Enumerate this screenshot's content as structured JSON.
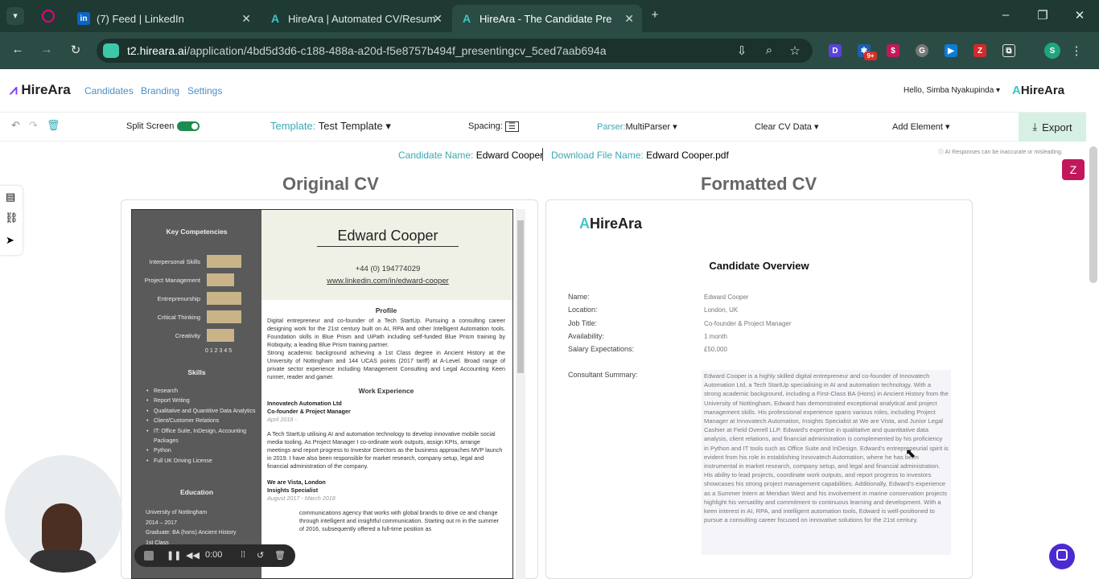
{
  "browser": {
    "tabs": [
      {
        "label": "(7) Feed | LinkedIn",
        "icon": "linkedin-icon"
      },
      {
        "label": "HireAra | Automated CV/Resum",
        "icon": "hireara-icon"
      },
      {
        "label": "HireAra - The Candidate Pre",
        "icon": "hireara-icon"
      }
    ],
    "url_host": "t2.hireara.ai",
    "url_path": "/application/4bd5d3d6-c188-488a-a20d-f5e8757b494f_presentingcv_5ced7aab694a",
    "badge_count": "9+",
    "profile_initial": "S",
    "theme_color": "#2b4c44"
  },
  "nav": {
    "brand": "HireAra",
    "links": [
      "Candidates",
      "Branding",
      "Settings"
    ],
    "greeting": "Hello, Simba Nyakupinda",
    "brand_right": "HireAra"
  },
  "toolbar": {
    "split_screen": "Split Screen",
    "toggle": "On",
    "template_label": "Template:",
    "template_value": "Test Template",
    "spacing": "Spacing:",
    "parser_label": "Parser:",
    "parser_value": "MultiParser",
    "clear": "Clear CV Data",
    "add": "Add Element",
    "export": "Export"
  },
  "candidate": {
    "name_label": "Candidate Name:",
    "name": "Edward Cooper",
    "file_label": "Download File Name:",
    "file": "Edward Cooper.pdf",
    "disclaimer": "AI Responses can be inaccurate or misleading."
  },
  "columns": {
    "original": "Original CV",
    "formatted": "Formatted CV"
  },
  "original_cv": {
    "name": "Edward Cooper",
    "phone": "+44 (0) 194774029",
    "linkedin": "www.linkedin.com/in/edward-cooper",
    "competencies_title": "Key Competencies",
    "competencies": [
      "Interpersonal Skills",
      "Project Management",
      "Entreprenurship",
      "Critical Thinking",
      "Creativity"
    ],
    "competency_levels": [
      5,
      4,
      5,
      5,
      4
    ],
    "scale": "0 1 2 3 4 5",
    "skills_title": "Skills",
    "skills": [
      "Research",
      "Report Writing",
      "Qualitative and Quantitive Data Analytics",
      "Client/Customer Relations",
      "IT: Office Suite, InDesign, Accounting Packages",
      "Python",
      "Full UK Driving License"
    ],
    "education_title": "Education",
    "education": [
      "University of Nottingham",
      "2014 – 2017",
      "Graduate: BA (hons) Ancient History 1st Class"
    ],
    "profile_title": "Profile",
    "profile": "Digital entrepreneur and co-founder of a Tech StartUp. Pursuing a consulting career designing work for the 21st century built on AI, RPA and other Intelligent Automation tools. Foundation skills in Blue Prism and UiPath including self-funded Blue Prism training by Robiquity, a leading Blue Prism training partner.",
    "profile2": "Strong academic background achieving a 1st Class degree in Ancient History at the University of Nottingham and 144 UCAS points (2017 tariff) at A-Level. Broad range of private sector experience including Management Consulting and Legal Accounting Keen runner, reader and gamer.",
    "work_title": "Work Experience",
    "job1_company": "Innovatech Automation Ltd",
    "job1_role": "Co-founder & Project Manager",
    "job1_date": "April 2018 -",
    "job1_desc": "A Tech StartUp utilising AI and automation technology to develop innovative mobile social media tooling. As Project Manager I co-ordinate work outputs, assign KPIs, arrange meetings and report progress to Investor Directors as the business approaches MVP launch in 2019. I have also been responsible for market research, company setup, legal and financial administration of the company.",
    "job2_company": "We are Vista, London",
    "job2_role": "Insights Specialist",
    "job2_date": "August 2017 - March 2018",
    "job2_desc": "communications agency that works with global brands to drive ce and change through intelligent and insightful communication. Starting out rn in the summer of 2016, subsequently offered a full-time position as"
  },
  "formatted_cv": {
    "logo": "HireAra",
    "title": "Candidate Overview",
    "fields": [
      {
        "label": "Name:",
        "value": "Edward Cooper"
      },
      {
        "label": "Location:",
        "value": "London, UK"
      },
      {
        "label": "Job Title:",
        "value": "Co-founder & Project Manager"
      },
      {
        "label": "Availability:",
        "value": "1 month"
      },
      {
        "label": "Salary Expectations:",
        "value": "£50,000"
      }
    ],
    "summary_label": "Consultant Summary:",
    "summary": "Edward Cooper is a highly skilled digital entrepreneur and co-founder of Innovatech Automation Ltd, a Tech StartUp specialising in AI and automation technology. With a strong academic background, including a First-Class BA (Hons) in Ancient History from the University of Nottingham, Edward has demonstrated exceptional analytical and project management skills. His professional experience spans various roles, including Project Manager at Innovatech Automation, Insights Specialist at We are Vista, and Junior Legal Cashier at Field Overell LLP. Edward's expertise in qualitative and quantitative data analysis, client relations, and financial administration is complemented by his proficiency in Python and IT tools such as Office Suite and InDesign. Edward's entrepreneurial spirit is evident from his role in establishing Innovatech Automation, where he has been instrumental in market research, company setup, and legal and financial administration. His ability to lead projects, coordinate work outputs, and report progress to investors showcases his strong project management capabilities. Additionally, Edward's experience as a Summer Intern at Meridian West and his involvement in marine conservation projects highlight his versatility and commitment to continuous learning and development. With a keen interest in AI, RPA, and intelligent automation tools, Edward is well-positioned to pursue a consulting career focused on innovative solutions for the 21st century."
  },
  "media": {
    "time": "0:00"
  }
}
